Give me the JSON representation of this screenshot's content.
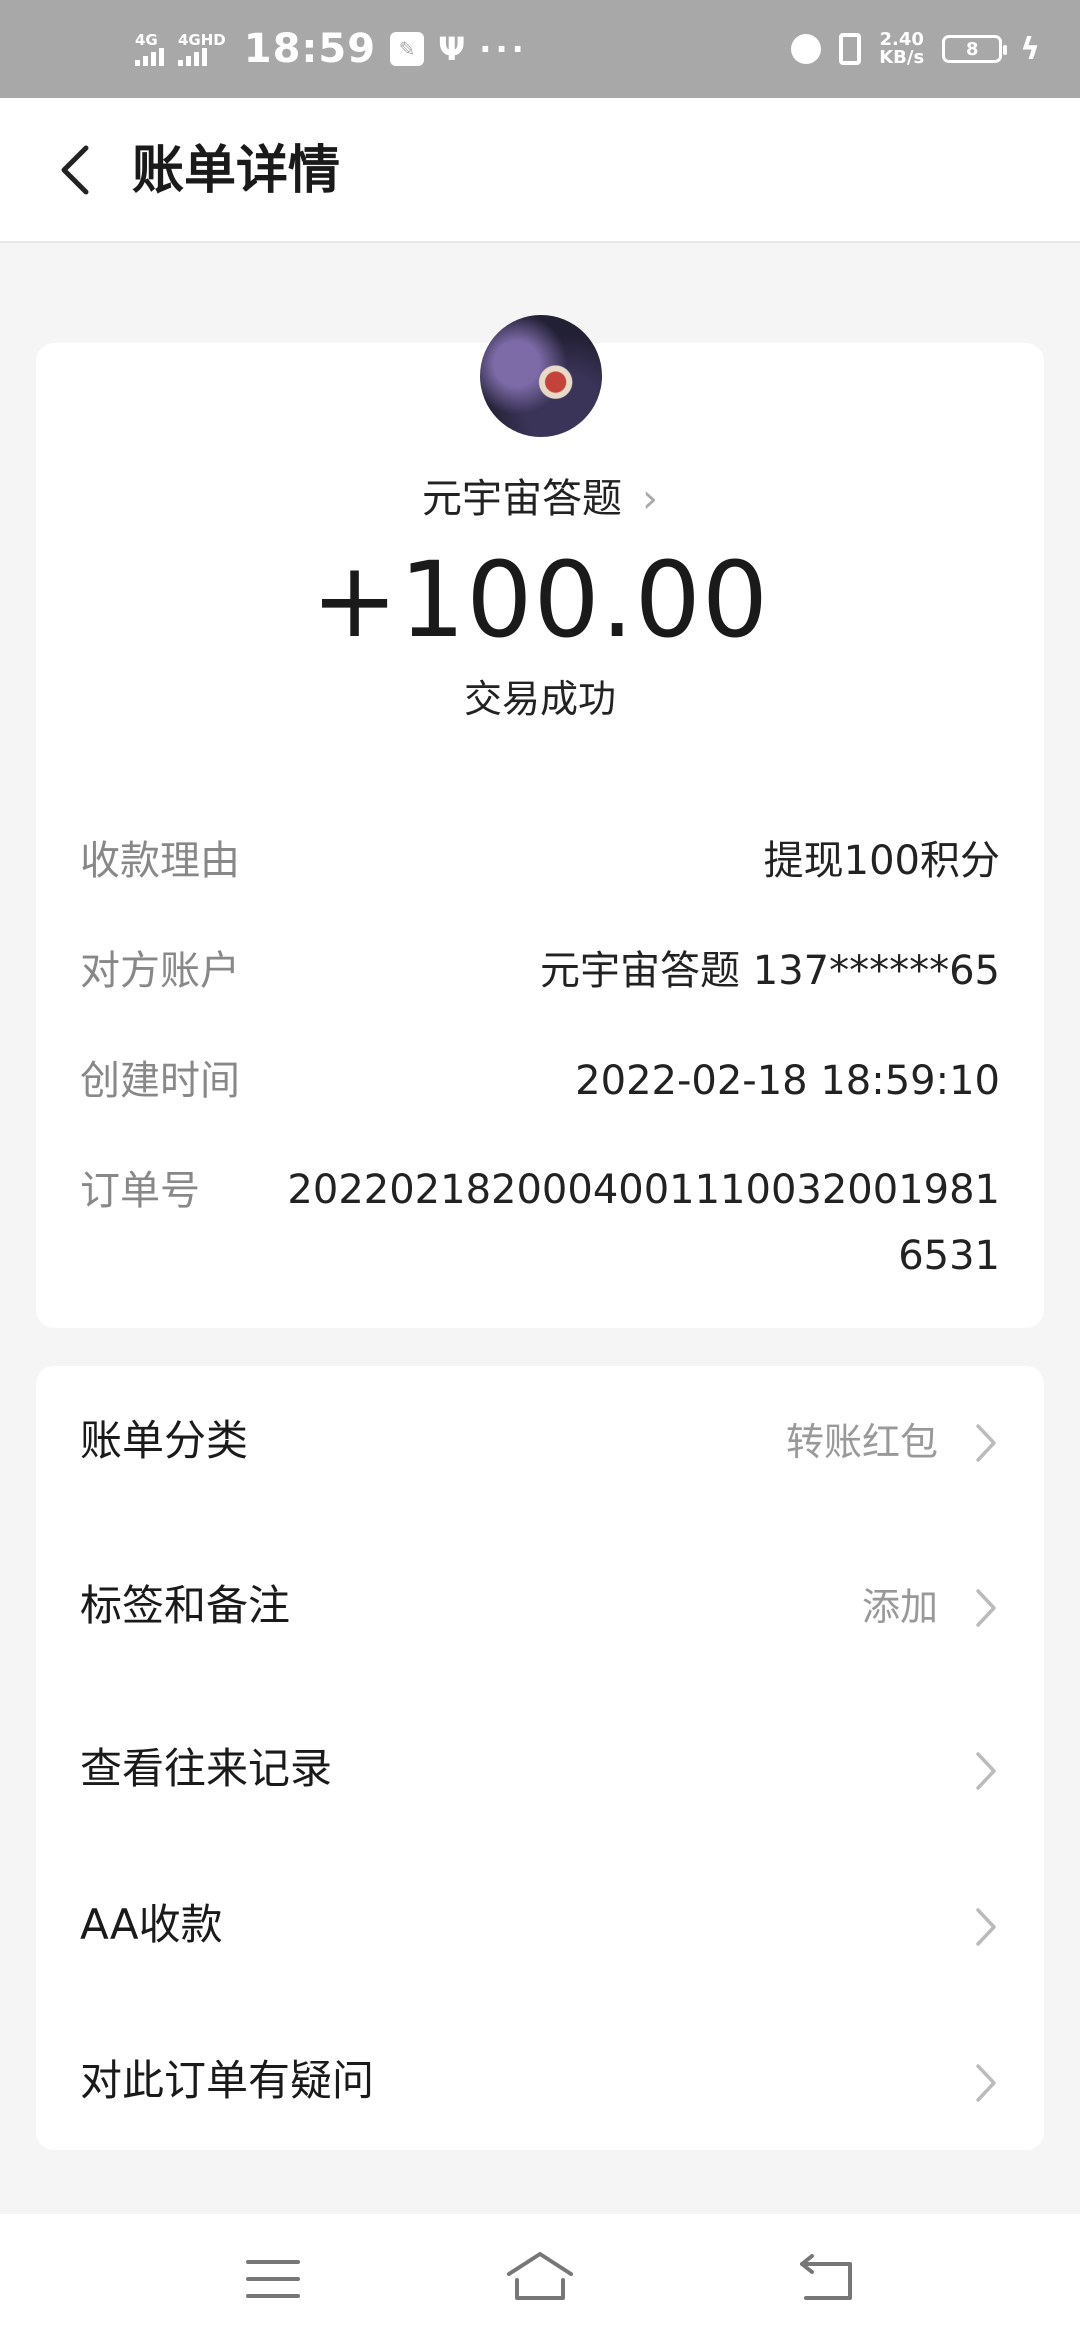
{
  "status_bar": {
    "net1": "4G",
    "net2": "4GHD",
    "time": "18:59",
    "speed_value": "2.40",
    "speed_unit": "KB/s",
    "battery": "8"
  },
  "header": {
    "title": "账单详情"
  },
  "summary": {
    "payee": "元宇宙答题",
    "amount": "+100.00",
    "status": "交易成功"
  },
  "details": [
    {
      "label": "收款理由",
      "value": "提现100积分"
    },
    {
      "label": "对方账户",
      "value": "元宇宙答题 137******65"
    },
    {
      "label": "创建时间",
      "value": "2022-02-18 18:59:10"
    },
    {
      "label": "订单号",
      "value": "20220218200040011100320019816531"
    }
  ],
  "actions": [
    {
      "label": "账单分类",
      "value": "转账红包"
    },
    {
      "label": "标签和备注",
      "value": "添加"
    },
    {
      "label": "查看往来记录",
      "value": ""
    },
    {
      "label": "AA收款",
      "value": ""
    },
    {
      "label": "对此订单有疑问",
      "value": ""
    }
  ]
}
